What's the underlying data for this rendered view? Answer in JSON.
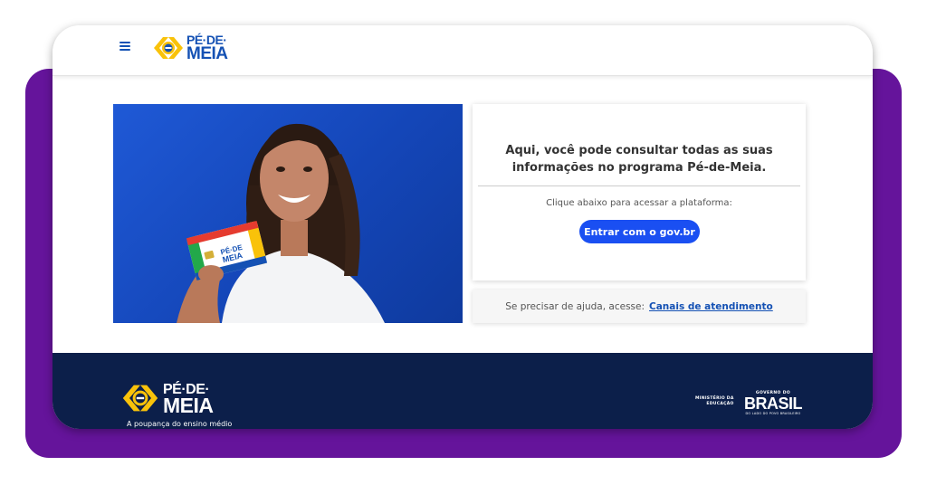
{
  "header": {
    "logo": {
      "line1": "PÉ·DE·",
      "line2": "MEIA"
    }
  },
  "main": {
    "info_title": "Aqui, você pode consultar todas as suas informações no programa Pé-de-Meia.",
    "info_subtitle": "Clique abaixo para acessar a plataforma:",
    "login_button": "Entrar com o gov.br",
    "help_text": "Se precisar de ajuda, acesse:",
    "help_link": "Canais de atendimento"
  },
  "footer": {
    "logo": {
      "line1": "PÉ·DE·",
      "line2": "MEIA"
    },
    "tagline": "A poupança do ensino médio",
    "ministry_line1": "MINISTÉRIO DA",
    "ministry_line2": "EDUCAÇÃO",
    "gov_label": "GOVERNO DO",
    "gov_word": "BRASIL",
    "gov_motto": "DO LADO DO POVO BRASILEIRO"
  },
  "colors": {
    "frame": "#65149b",
    "primary": "#1451b4",
    "button": "#1a4ff2",
    "footer": "#0c1f4a"
  }
}
